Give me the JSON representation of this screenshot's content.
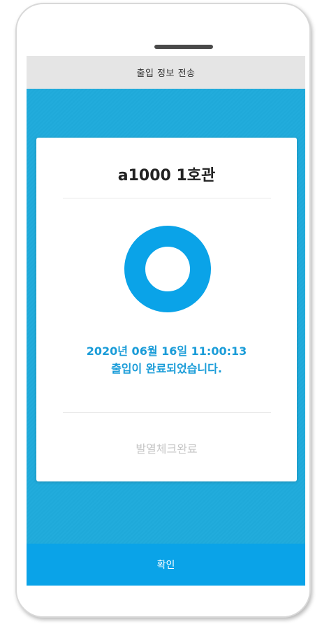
{
  "header": {
    "title": "출입 정보 전송"
  },
  "card": {
    "place_name": "a1000 1호관",
    "status_icon": "o-circle-icon",
    "timestamp": "2020년 06월 16일 11:00:13",
    "message": "출입이 완료되었습니다.",
    "fever_check_label": "발열체크완료"
  },
  "footer": {
    "confirm_label": "확인"
  },
  "colors": {
    "accent": "#1a9cd8",
    "background": "#1ea8d8",
    "button": "#0aa3e8",
    "title_bar": "#e5e5e5",
    "muted_text": "#c6c6c6"
  }
}
